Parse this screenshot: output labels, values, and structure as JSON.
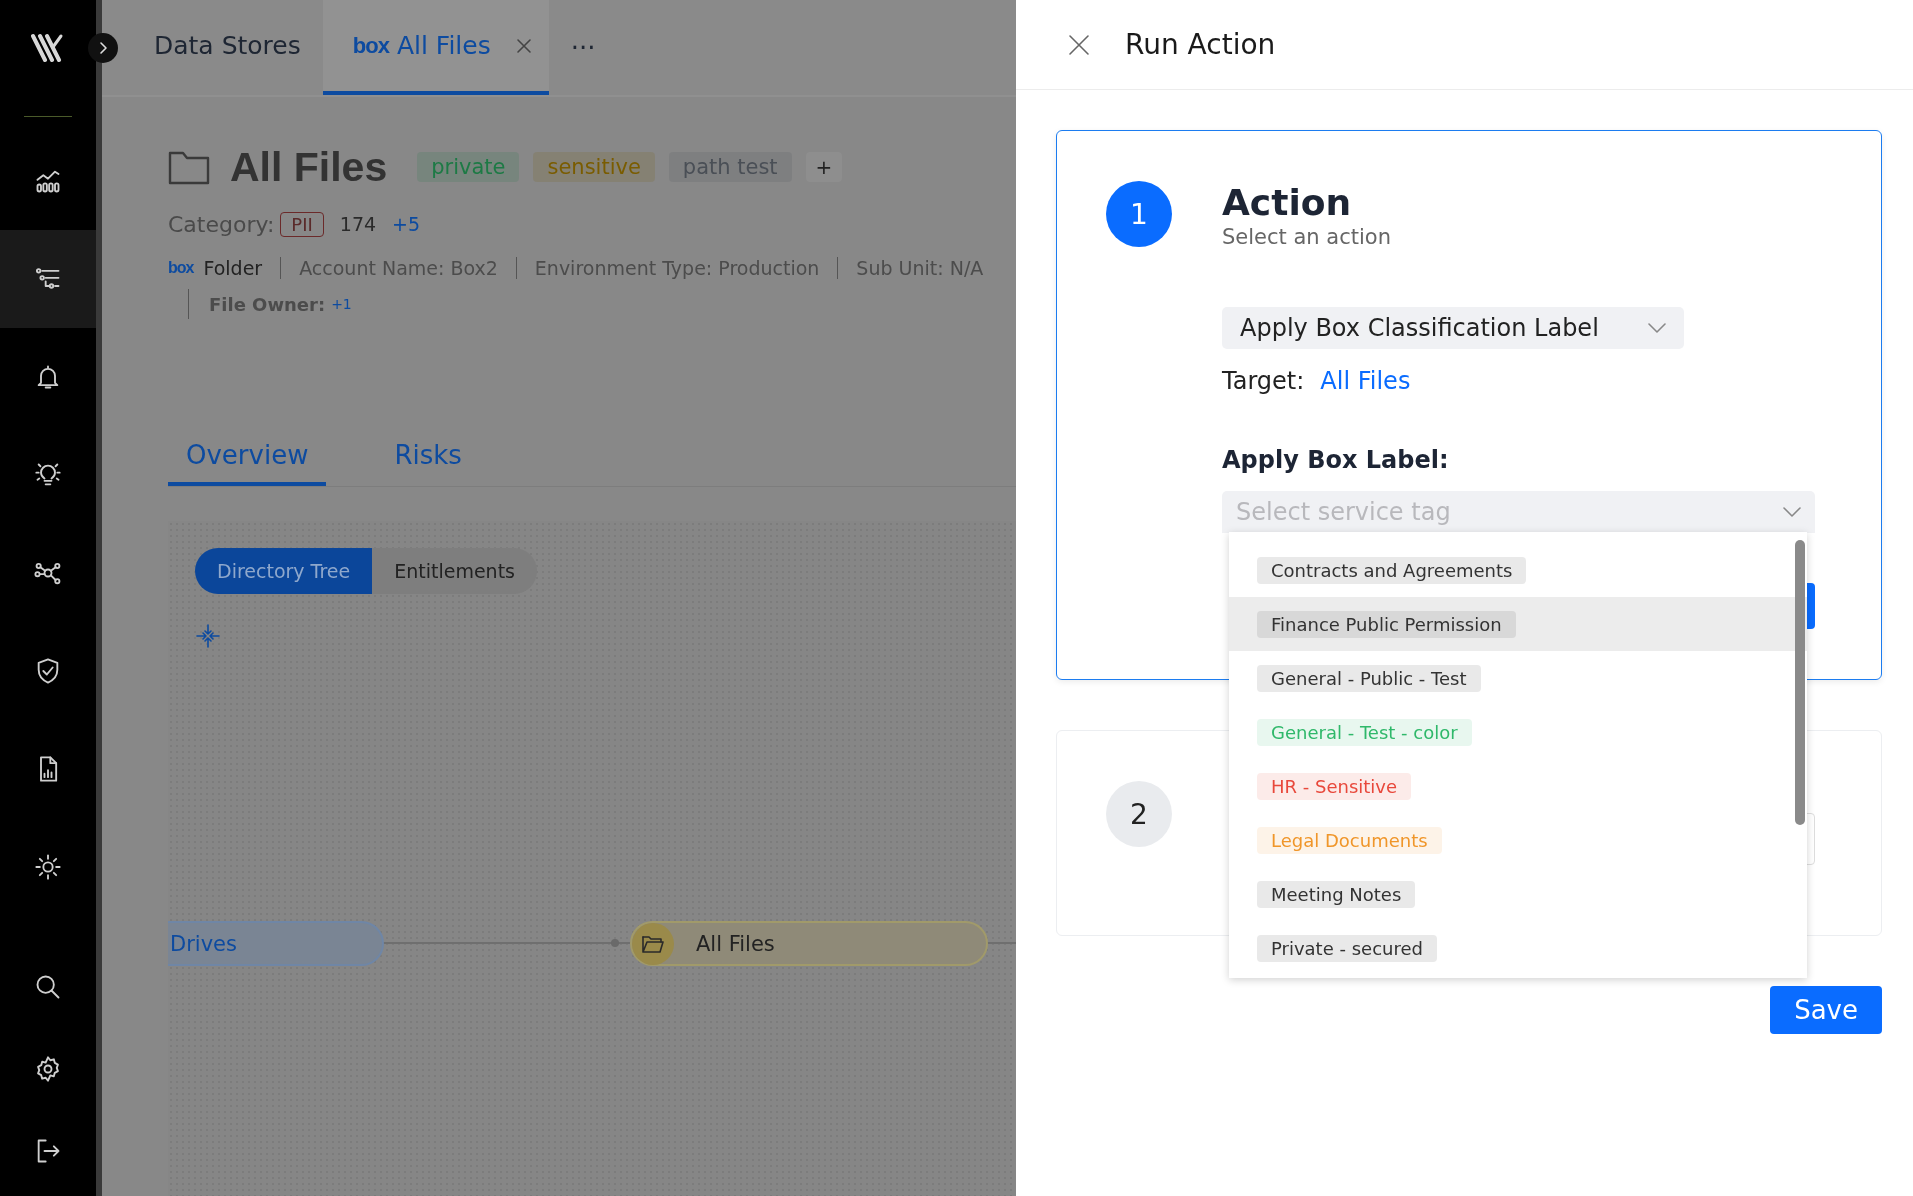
{
  "sidebar": {
    "items": [
      {
        "kind": "chart",
        "selected": false
      },
      {
        "kind": "filters",
        "selected": true
      },
      {
        "kind": "bell",
        "selected": false
      },
      {
        "kind": "bulb",
        "selected": false
      },
      {
        "kind": "network",
        "selected": false
      },
      {
        "kind": "shield",
        "selected": false
      },
      {
        "kind": "report",
        "selected": false
      },
      {
        "kind": "sun",
        "selected": false
      }
    ],
    "bottom_items": [
      {
        "kind": "search"
      },
      {
        "kind": "gear"
      },
      {
        "kind": "logout"
      }
    ]
  },
  "header_tabs": [
    {
      "label": "Data Stores",
      "selected": false
    },
    {
      "label": "All Files",
      "logo_text": "box",
      "selected": true,
      "closable": true
    }
  ],
  "header_more": "···",
  "page": {
    "title": "All Files",
    "tags": [
      {
        "label": "private",
        "color": "#1d7a45"
      },
      {
        "label": "sensitive",
        "color": "#7a5c00"
      },
      {
        "label": "path test",
        "color": "#4a4f56"
      }
    ],
    "add_tag": "+",
    "category_label": "Category:",
    "category": "PII",
    "count": "174",
    "more": "+5",
    "meta": {
      "logo_text": "box",
      "type": "Folder",
      "fields": [
        "Account Name: Box2",
        "Environment Type: Production",
        "Sub Unit: N/A"
      ],
      "owner_label": "File Owner:",
      "owner_more": "+1"
    }
  },
  "content_tabs": [
    {
      "label": "Overview",
      "selected": true
    },
    {
      "label": "Risks",
      "selected": false
    }
  ],
  "view_toggle": [
    {
      "label": "Directory Tree",
      "selected": true
    },
    {
      "label": "Entitlements",
      "selected": false
    }
  ],
  "tree_nodes": [
    {
      "label": "Drives",
      "kind": "root"
    },
    {
      "label": "All Files",
      "kind": "folder"
    }
  ],
  "panel": {
    "title": "Run Action",
    "step1": {
      "number": "1",
      "active": true,
      "title": "Action",
      "subtitle": "Select an action",
      "action": "Apply Box Classification Label",
      "target_label": "Target:",
      "target": "All Files",
      "label_heading": "Apply Box Label:",
      "select": {
        "placeholder": "Select service tag",
        "expanded": true
      }
    },
    "step2": {
      "number": "2",
      "active": false
    },
    "options": [
      {
        "label": "Contracts and Agreements",
        "color": "#333333",
        "highlighted": false
      },
      {
        "label": "Finance Public Permission",
        "color": "#333333",
        "highlighted": true
      },
      {
        "label": "General - Public - Test",
        "color": "#333333",
        "highlighted": false
      },
      {
        "label": "General - Test - color",
        "color": "#2fb86a",
        "highlighted": false
      },
      {
        "label": "HR - Sensitive",
        "color": "#e8483b",
        "highlighted": false
      },
      {
        "label": "Legal Documents",
        "color": "#f0962a",
        "highlighted": false
      },
      {
        "label": "Meeting Notes",
        "color": "#333333",
        "highlighted": false
      },
      {
        "label": "Private - secured",
        "color": "#333333",
        "highlighted": false
      }
    ],
    "save": "Save"
  }
}
